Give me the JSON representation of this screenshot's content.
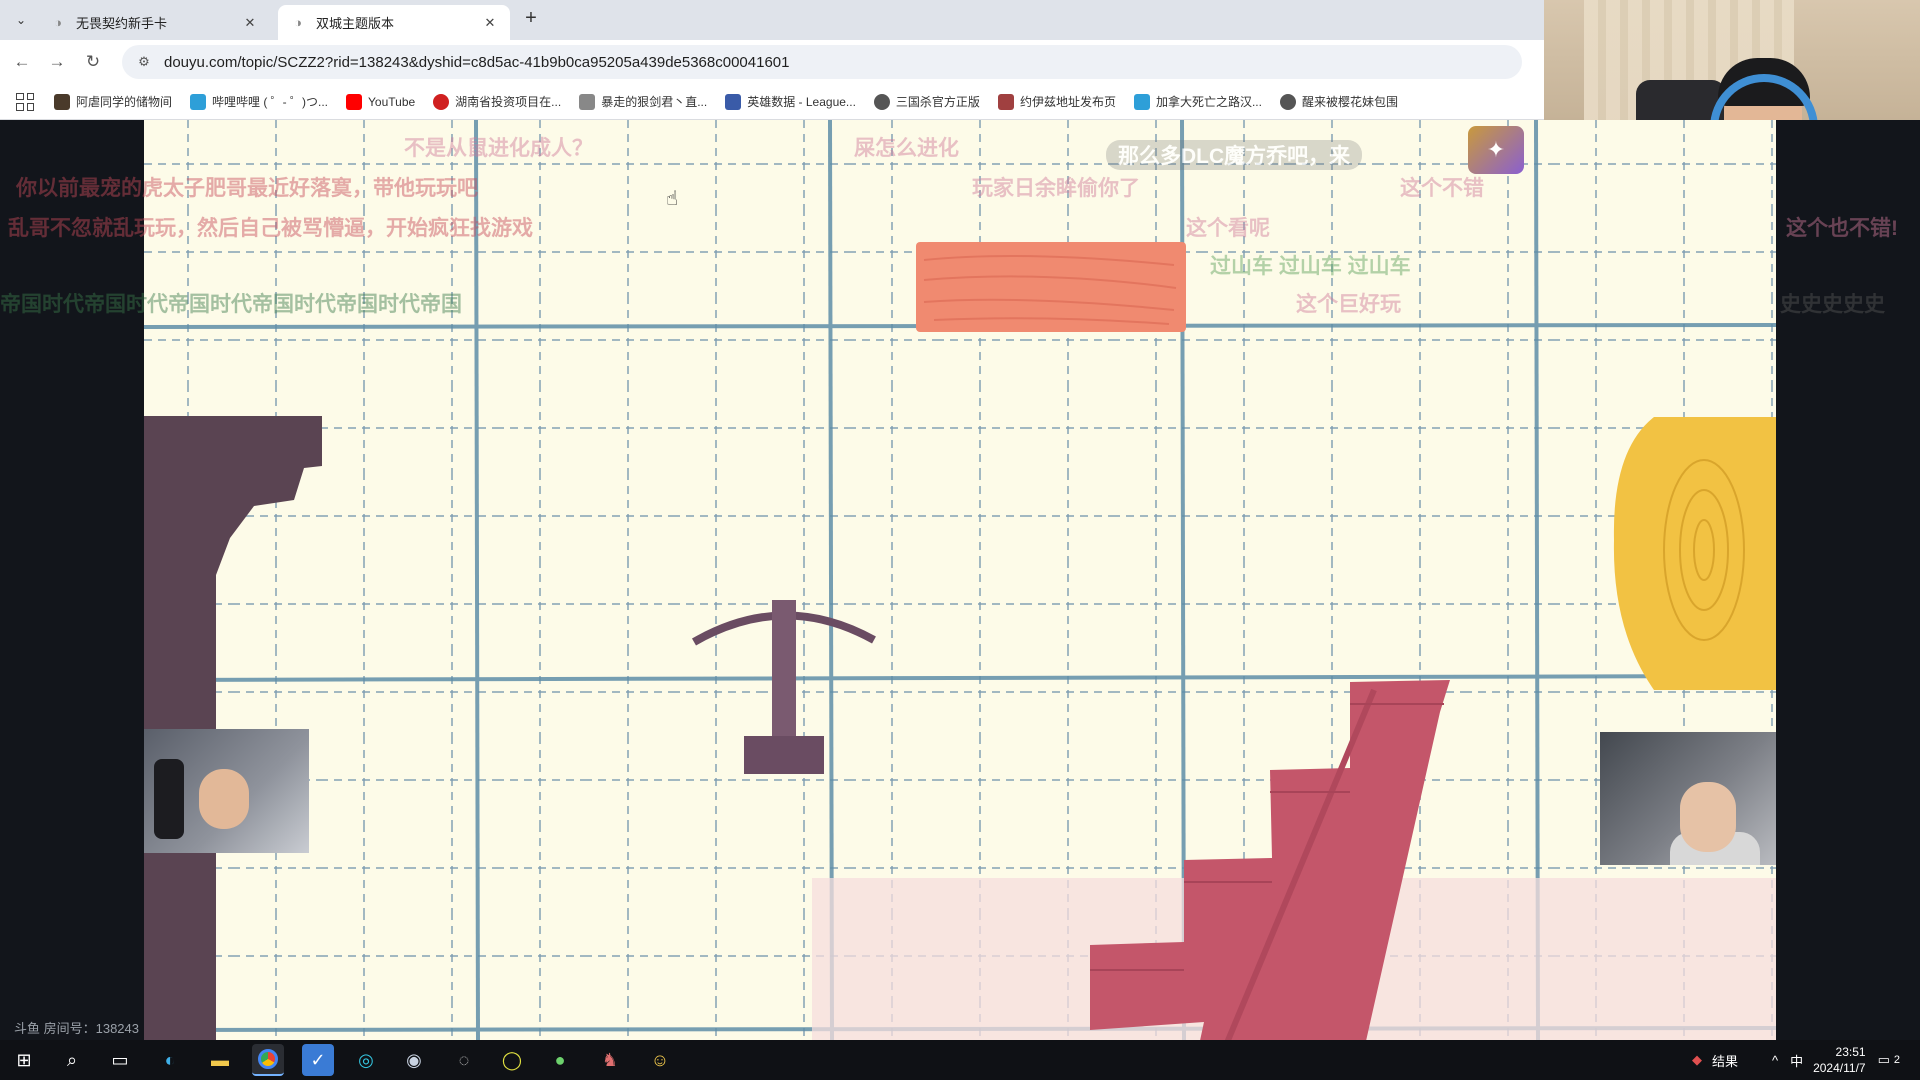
{
  "browser": {
    "tabs": [
      {
        "title": "无畏契约新手卡",
        "active": false
      },
      {
        "title": "双城主题版本",
        "active": true
      }
    ],
    "url": "douyu.com/topic/SCZZ2?rid=138243&dyshid=c8d5ac-41b9b0ca95205a439de5368c00041601",
    "bookmarks": [
      {
        "label": "阿虐同学的储物间",
        "color": "#4a3a2a"
      },
      {
        "label": "哔哩哔哩 ( ゜- ゜)つ...",
        "color": "#2e9fd8"
      },
      {
        "label": "YouTube",
        "color": "#ff0000"
      },
      {
        "label": "湖南省投资项目在...",
        "color": "#d02020"
      },
      {
        "label": "暴走的狠剑君丶直...",
        "color": "#888888"
      },
      {
        "label": "英雄数据 - League...",
        "color": "#3a5ba8"
      },
      {
        "label": "三国杀官方正版",
        "color": "#555555"
      },
      {
        "label": "约伊兹地址发布页",
        "color": "#a04040"
      },
      {
        "label": "加拿大死亡之路汉...",
        "color": "#2e9fd8"
      },
      {
        "label": "醒来被樱花妹包围",
        "color": "#555555"
      }
    ]
  },
  "stream": {
    "room_id": "斗鱼 房间号：138243",
    "danmu": [
      {
        "text": "不是从鼠进化成人？",
        "color": "#d07a9a"
      },
      {
        "text": "屎怎么进化",
        "color": "#d07a9a"
      },
      {
        "text": "那么多DLC魔方乔吧，来",
        "color": "#9a9a9a"
      },
      {
        "text": "你以前最宠的虎太子肥哥最近好落寞，带他玩玩吧",
        "color": "#c84a5a"
      },
      {
        "text": "玩家日余眸偷你了",
        "color": "#d07a9a"
      },
      {
        "text": "这个不错",
        "color": "#d07a9a"
      },
      {
        "text": "乱哥不忽就乱玩玩，然后自己被骂懵逼，开始疯狂找游戏",
        "color": "#c84a5a"
      },
      {
        "text": "这个看呢",
        "color": "#d07a9a"
      },
      {
        "text": "这个也不错!",
        "color": "#d07a9a"
      },
      {
        "text": "过山车 过山车 过山车",
        "color": "#5aa05a"
      },
      {
        "text": "帝国时代帝国时代帝国时代帝国时代帝国时代帝国",
        "color": "#3a7a4a"
      },
      {
        "text": "这个巨好玩",
        "color": "#d07a9a"
      },
      {
        "text": "史史史史史",
        "color": "#555555"
      }
    ]
  },
  "taskbar": {
    "ime_label": "结果",
    "lang": "中",
    "time": "23:51",
    "date": "2024/11/7",
    "notifications": "2"
  },
  "icons": [
    "windows-start-icon",
    "search-icon",
    "task-view-icon",
    "edge-icon",
    "file-explorer-icon",
    "chrome-icon",
    "feishu-icon",
    "app-icon",
    "steam-icon",
    "app-icon-2",
    "app-icon-3",
    "app-icon-4",
    "game-icon",
    "app-icon-5"
  ]
}
